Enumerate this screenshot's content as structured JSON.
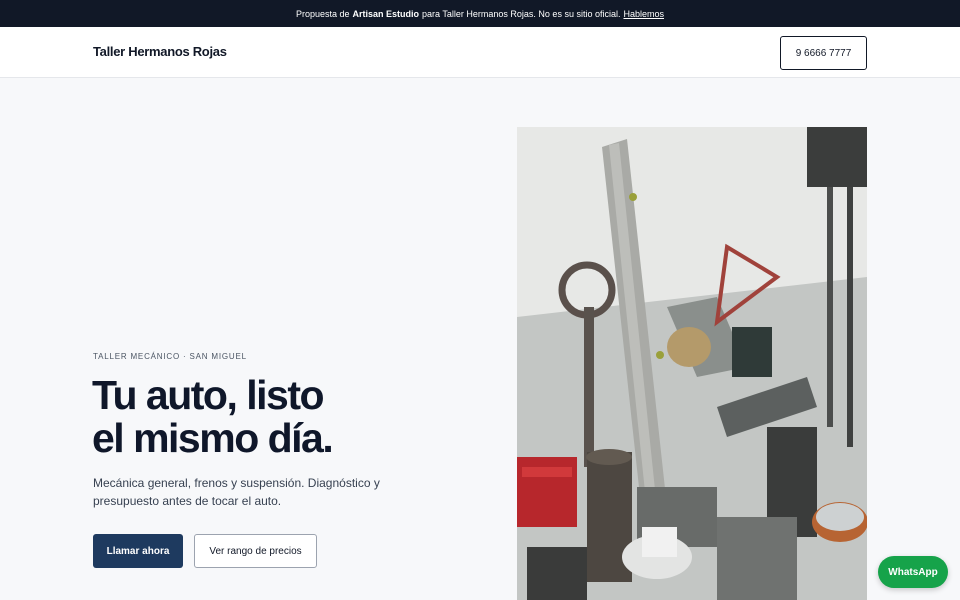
{
  "topbar": {
    "prefix": "Propuesta de",
    "studio": "Artisan Estudio",
    "middle": "para Taller Hermanos Rojas. No es su sitio oficial.",
    "link": "Hablemos"
  },
  "header": {
    "brand": "Taller Hermanos Rojas",
    "phone": "9 6666 7777"
  },
  "hero": {
    "eyebrow": "TALLER MECÁNICO · SAN MIGUEL",
    "headline_line1": "Tu auto, listo",
    "headline_line2": "el mismo día.",
    "lead": "Mecánica general, frenos y suspensión. Diagnóstico y presupuesto antes de tocar el auto.",
    "primary_cta": "Llamar ahora",
    "secondary_cta": "Ver rango de precios"
  },
  "floating": {
    "whatsapp": "WhatsApp"
  },
  "colors": {
    "topbar_bg": "#111827",
    "primary": "#1e3a5f",
    "whatsapp": "#16a34a",
    "page_bg": "#f7f8fa"
  }
}
